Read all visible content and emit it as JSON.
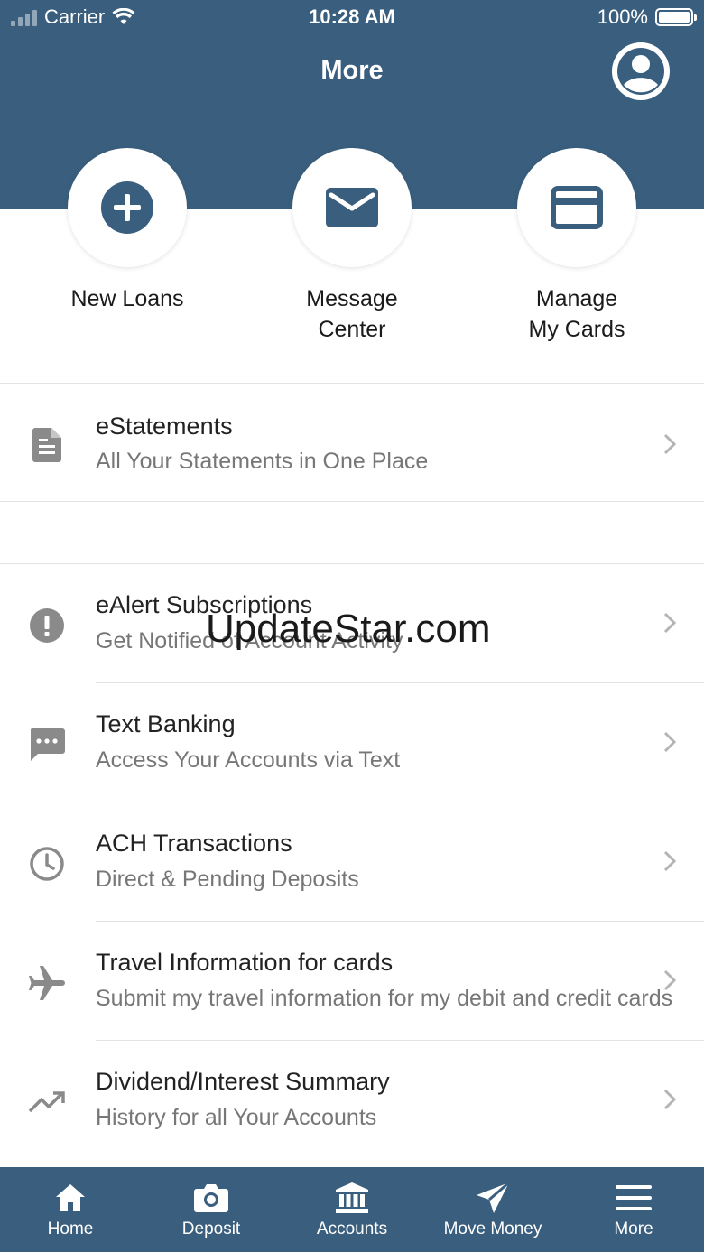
{
  "status_bar": {
    "carrier": "Carrier",
    "time": "10:28 AM",
    "battery": "100%"
  },
  "header": {
    "title": "More"
  },
  "quick_actions": [
    {
      "label_line1": "New Loans",
      "label_line2": "",
      "icon": "plus-circle-icon"
    },
    {
      "label_line1": "Message",
      "label_line2": "Center",
      "icon": "envelope-icon"
    },
    {
      "label_line1": "Manage",
      "label_line2": "My Cards",
      "icon": "credit-card-icon"
    }
  ],
  "menu_items": [
    {
      "title": "eStatements",
      "subtitle": "All Your Statements in One Place",
      "icon": "document-icon"
    },
    {
      "title": "eAlert Subscriptions",
      "subtitle": "Get Notified of Account Activity",
      "icon": "alert-icon"
    },
    {
      "title": "Text Banking",
      "subtitle": "Access Your Accounts via Text",
      "icon": "chat-icon"
    },
    {
      "title": "ACH Transactions",
      "subtitle": "Direct & Pending Deposits",
      "icon": "clock-icon"
    },
    {
      "title": "Travel Information for cards",
      "subtitle": "Submit my travel information for my debit and credit cards",
      "icon": "airplane-icon"
    },
    {
      "title": "Dividend/Interest Summary",
      "subtitle": "History for all Your Accounts",
      "icon": "trending-up-icon"
    }
  ],
  "watermark": "UpdateStar.com",
  "tabs": [
    {
      "label": "Home",
      "icon": "home-icon"
    },
    {
      "label": "Deposit",
      "icon": "camera-icon"
    },
    {
      "label": "Accounts",
      "icon": "bank-icon"
    },
    {
      "label": "Move Money",
      "icon": "send-icon"
    },
    {
      "label": "More",
      "icon": "menu-icon"
    }
  ],
  "colors": {
    "brand": "#3a5f7e",
    "icon_gray": "#8a8a8a"
  }
}
